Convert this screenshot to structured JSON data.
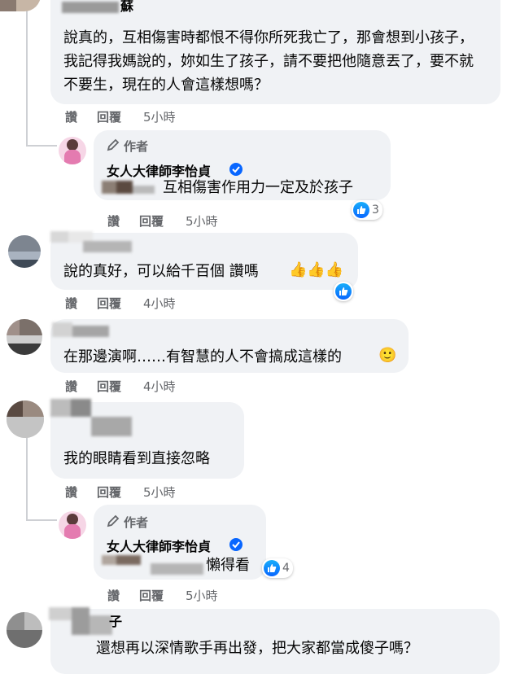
{
  "actions": {
    "like": "讚",
    "reply": "回覆"
  },
  "author": {
    "tag": "作者",
    "name": "女人大律師李怡貞"
  },
  "comments": [
    {
      "name_fragment": "蘇",
      "text": "說真的，互相傷害時都恨不得你所死我亡了，那會想到小孩子，我記得我媽說的，妳如生了孩子，請不要把他隨意丟了，要不就不要生，現在的人會這樣想嗎？",
      "time": "5小時"
    },
    {
      "text": "說的真好，可以給千百個 讚嗎",
      "emoji": "👍👍👍",
      "time": "4小時"
    },
    {
      "text": "在那邊演啊……有智慧的人不會搞成這樣的",
      "emoji": "🙂",
      "time": "4小時"
    },
    {
      "text": "我的眼睛看到直接忽略",
      "time": "5小時"
    },
    {
      "name_fragment": "子",
      "text": "還想再以深情歌手再出發，把大家都當成傻子嗎？"
    }
  ],
  "replies": [
    {
      "text": "互相傷害作用力一定及於孩子",
      "time": "5小時",
      "likes": "3"
    },
    {
      "text": "懶得看",
      "time": "5小時",
      "likes": "4"
    }
  ],
  "colors": {
    "bubble": "#f0f2f5",
    "meta": "#65676b",
    "like_blue": "#0866ff",
    "verified": "#0866ff"
  }
}
